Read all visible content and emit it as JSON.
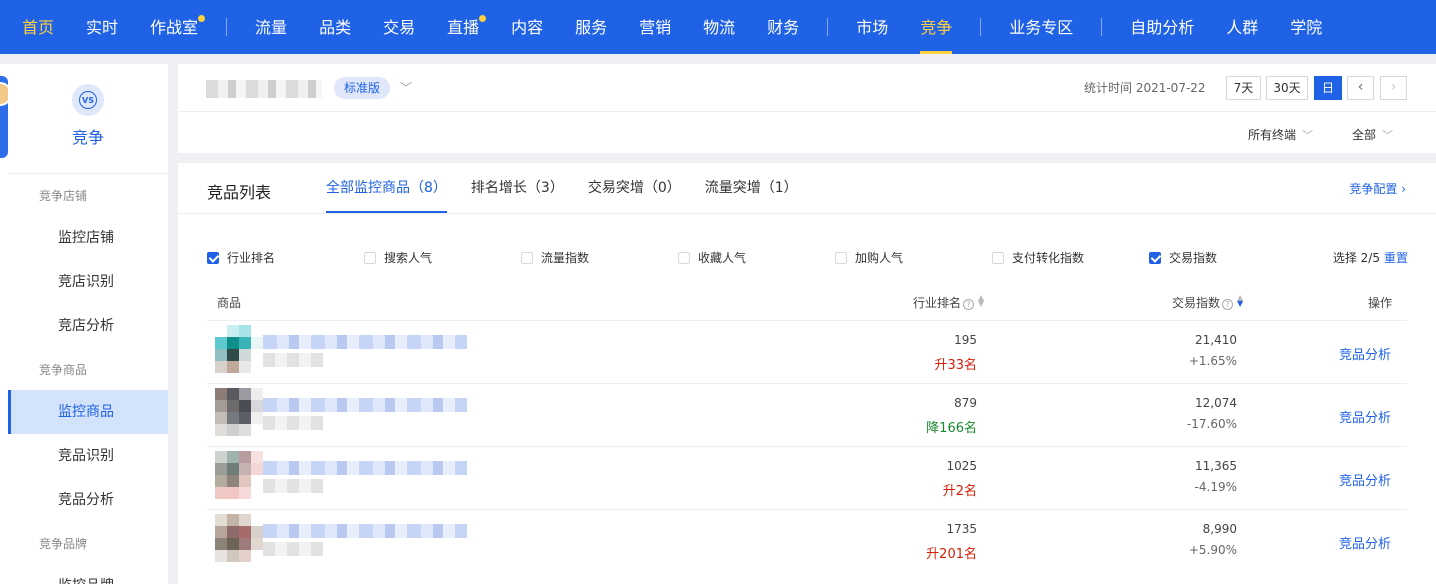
{
  "nav": {
    "groups": [
      [
        {
          "label": "首页",
          "dot": false,
          "home": true
        },
        {
          "label": "实时",
          "dot": false
        },
        {
          "label": "作战室",
          "dot": true
        }
      ],
      [
        {
          "label": "流量",
          "dot": false
        },
        {
          "label": "品类",
          "dot": false
        },
        {
          "label": "交易",
          "dot": false
        },
        {
          "label": "直播",
          "dot": true
        },
        {
          "label": "内容",
          "dot": false
        },
        {
          "label": "服务",
          "dot": false
        },
        {
          "label": "营销",
          "dot": false
        },
        {
          "label": "物流",
          "dot": false
        },
        {
          "label": "财务",
          "dot": false
        }
      ],
      [
        {
          "label": "市场",
          "dot": false
        },
        {
          "label": "竞争",
          "dot": false,
          "active": true
        }
      ],
      [
        {
          "label": "业务专区",
          "dot": false
        }
      ],
      [
        {
          "label": "自助分析",
          "dot": false
        },
        {
          "label": "人群",
          "dot": false
        },
        {
          "label": "学院",
          "dot": false
        }
      ]
    ]
  },
  "sidebar": {
    "title": "竞争",
    "icon_text": "VS",
    "sections": [
      {
        "label": "竞争店铺",
        "items": [
          {
            "label": "监控店铺"
          },
          {
            "label": "竞店识别"
          },
          {
            "label": "竞店分析"
          }
        ]
      },
      {
        "label": "竞争商品",
        "items": [
          {
            "label": "监控商品",
            "active": true
          },
          {
            "label": "竞品识别"
          },
          {
            "label": "竞品分析"
          }
        ]
      },
      {
        "label": "竞争品牌",
        "items": [
          {
            "label": "监控品牌"
          }
        ]
      }
    ]
  },
  "header": {
    "version_badge": "标准版",
    "stat_time": "统计时间 2021-07-22",
    "ranges": [
      "7天",
      "30天",
      "日"
    ],
    "active_range": "日",
    "terminal_filter": "所有终端",
    "scope_filter": "全部"
  },
  "list": {
    "title": "竞品列表",
    "tabs": [
      {
        "label": "全部监控商品（8）",
        "active": true
      },
      {
        "label": "排名增长（3）"
      },
      {
        "label": "交易突增（0）"
      },
      {
        "label": "流量突增（1）"
      }
    ],
    "config_link": "竞争配置",
    "metrics": [
      {
        "label": "行业排名",
        "checked": true
      },
      {
        "label": "搜索人气",
        "checked": false
      },
      {
        "label": "流量指数",
        "checked": false
      },
      {
        "label": "收藏人气",
        "checked": false
      },
      {
        "label": "加购人气",
        "checked": false
      },
      {
        "label": "支付转化指数",
        "checked": false
      },
      {
        "label": "交易指数",
        "checked": true
      }
    ],
    "selected_count": "选择 2/5",
    "reset_label": "重置",
    "columns": {
      "product": "商品",
      "rank": "行业排名",
      "trade": "交易指数",
      "op": "操作"
    },
    "rows": [
      {
        "rank": "195",
        "rank_change": "升33名",
        "dir": "up",
        "trade": "21,410",
        "trade_change": "+1.65%",
        "op": "竞品分析",
        "thumb": [
          "#ffffff",
          "#c9eef0",
          "#a6e3e6",
          "#ffffff",
          "#5ec9cf",
          "#0e8f8a",
          "#3ab4b7",
          "#e8f6f7",
          "#8fbfbf",
          "#2f4a49",
          "#cfd9d8",
          "#ffffff",
          "#d9d2cc",
          "#bfa99b",
          "#e8e8e8",
          "#ffffff"
        ]
      },
      {
        "rank": "879",
        "rank_change": "降166名",
        "dir": "down",
        "trade": "12,074",
        "trade_change": "-17.60%",
        "op": "竞品分析",
        "thumb": [
          "#8b7d76",
          "#5b5a5e",
          "#9a9aa0",
          "#eeeeee",
          "#a49c94",
          "#6e6b6c",
          "#4b4d55",
          "#d8d8dc",
          "#c3bcb5",
          "#767a80",
          "#5c5f66",
          "#f0f0f0",
          "#e0dcd9",
          "#cfcfd2",
          "#dddde0",
          "#ffffff"
        ]
      },
      {
        "rank": "1025",
        "rank_change": "升2名",
        "dir": "up",
        "trade": "11,365",
        "trade_change": "-4.19%",
        "op": "竞品分析",
        "thumb": [
          "#cfd3cf",
          "#9fb2ad",
          "#b79ca0",
          "#f6e0e0",
          "#9a9c95",
          "#6f7c78",
          "#c5b3b2",
          "#f4d6d6",
          "#b4ab9f",
          "#8f857c",
          "#e1c6bd",
          "#ffffff",
          "#f1c9c4",
          "#f3c6c4",
          "#f6dada",
          "#ffffff"
        ]
      },
      {
        "rank": "1735",
        "rank_change": "升201名",
        "dir": "up",
        "trade": "8,990",
        "trade_change": "+5.90%",
        "op": "竞品分析",
        "thumb": [
          "#e3dcd3",
          "#c2b3a4",
          "#ded6cf",
          "#ffffff",
          "#b6a79a",
          "#8d6a6c",
          "#a66b6b",
          "#d8d1cb",
          "#8c8478",
          "#6e6456",
          "#9f7a7a",
          "#e0d7d1",
          "#e8e3e0",
          "#d0c7bf",
          "#e5d1cc",
          "#ffffff"
        ]
      }
    ]
  }
}
